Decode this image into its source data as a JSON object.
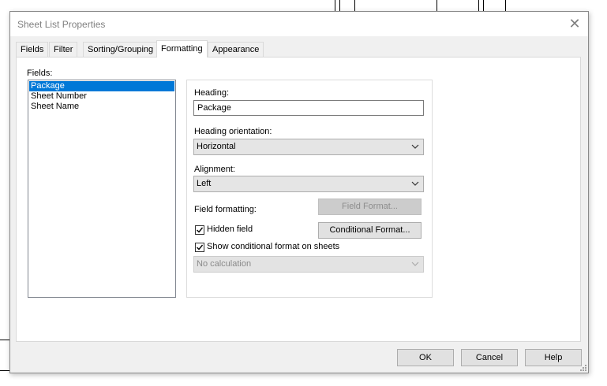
{
  "dialog": {
    "title": "Sheet List Properties",
    "close_glyph": "✕"
  },
  "tabs": [
    {
      "label": "Fields",
      "active": false
    },
    {
      "label": "Filter",
      "active": false
    },
    {
      "label": "Sorting/Grouping",
      "active": false
    },
    {
      "label": "Formatting",
      "active": true
    },
    {
      "label": "Appearance",
      "active": false
    }
  ],
  "fields": {
    "label": "Fields:",
    "items": [
      "Package",
      "Sheet Number",
      "Sheet Name"
    ],
    "selected_index": 0
  },
  "formatting": {
    "heading_label": "Heading:",
    "heading_value": "Package",
    "orientation_label": "Heading orientation:",
    "orientation_value": "Horizontal",
    "alignment_label": "Alignment:",
    "alignment_value": "Left",
    "field_formatting_label": "Field formatting:",
    "field_format_button": "Field Format...",
    "hidden_field_label": "Hidden field",
    "hidden_field_checked": true,
    "conditional_format_button": "Conditional  Format...",
    "show_conditional_label": "Show conditional format on sheets",
    "show_conditional_checked": true,
    "calculation_value": "No calculation"
  },
  "footer": {
    "ok": "OK",
    "cancel": "Cancel",
    "help": "Help"
  },
  "colors": {
    "selection": "#0078d7",
    "dialog_bg": "#f0f0f0"
  }
}
